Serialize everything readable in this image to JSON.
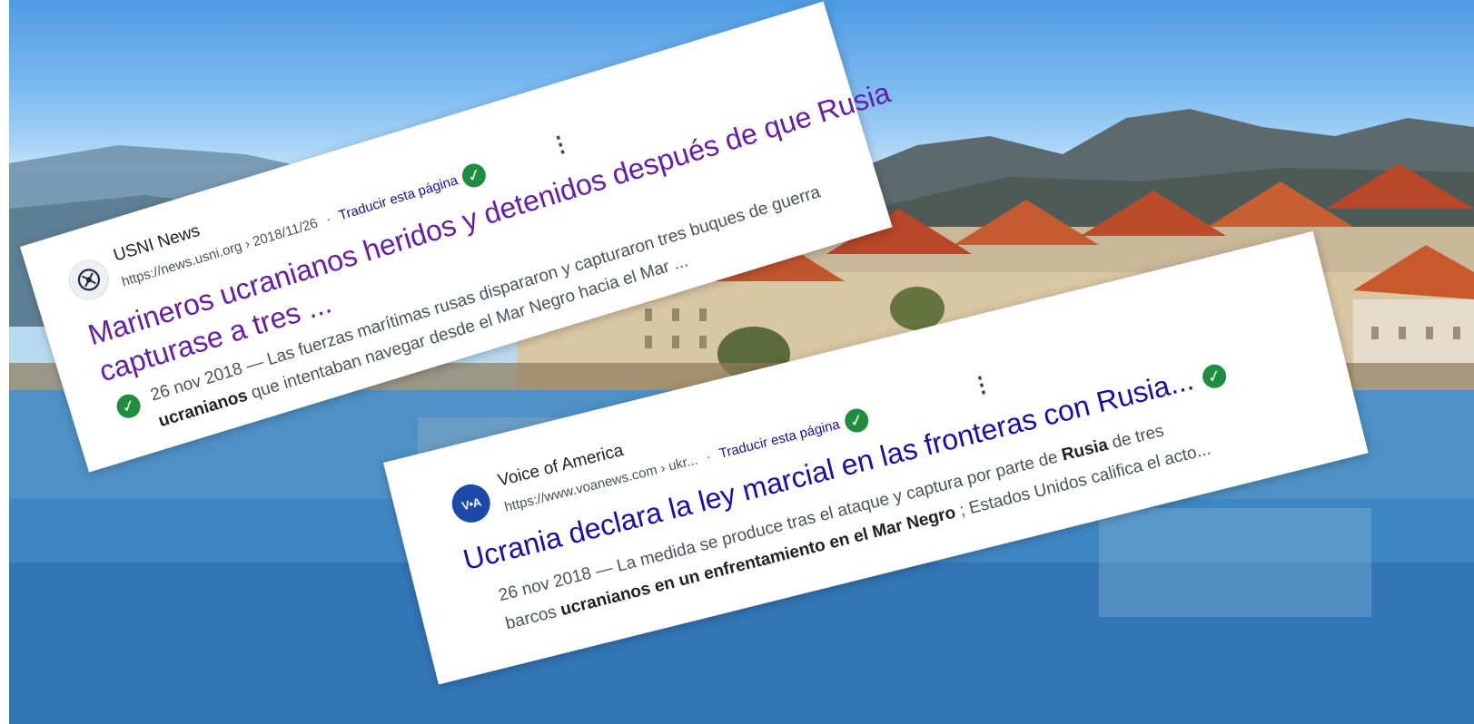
{
  "results": [
    {
      "site_name": "USNI News",
      "url": "https://news.usni.org",
      "path": "› 2018/11/26",
      "translate": "Traducir esta página",
      "title_line1": "Marineros ucranianos heridos y detenidos después de que Rusia",
      "title_line2": "capturase a tres ...",
      "date": "26 nov 2018",
      "snippet_line1": "— Las fuerzas marítimas rusas dispararon y capturaron tres buques de guerra",
      "snippet_bold1": "ucranianos",
      "snippet_line2": "que intentaban navegar desde el Mar Negro hacia el Mar ...",
      "favicon": "usni-anchor-icon"
    },
    {
      "site_name": "Voice of America",
      "url": "https://www.voanews.com",
      "path": "› ukr...",
      "translate": "Traducir esta página",
      "title": "Ucrania declara la ley marcial en las fronteras con Rusia...",
      "date": "26 nov 2018",
      "snippet_line1_a": "— La medida se produce tras el ataque y captura por parte de",
      "snippet_bold_a": "Rusia",
      "snippet_line1_b": "de tres",
      "snippet_line2_a": "barcos",
      "snippet_bold_b": "ucranianos en un enfrentamiento en el Mar Negro",
      "snippet_line2_b": "; Estados Unidos califica el acto...",
      "favicon_text": "V•A"
    }
  ],
  "colors": {
    "visited_link": "#681da8",
    "link": "#1a0dab",
    "verified": "#1e8e3e",
    "sky": "#7ab9f0",
    "river": "#3f87c4"
  }
}
